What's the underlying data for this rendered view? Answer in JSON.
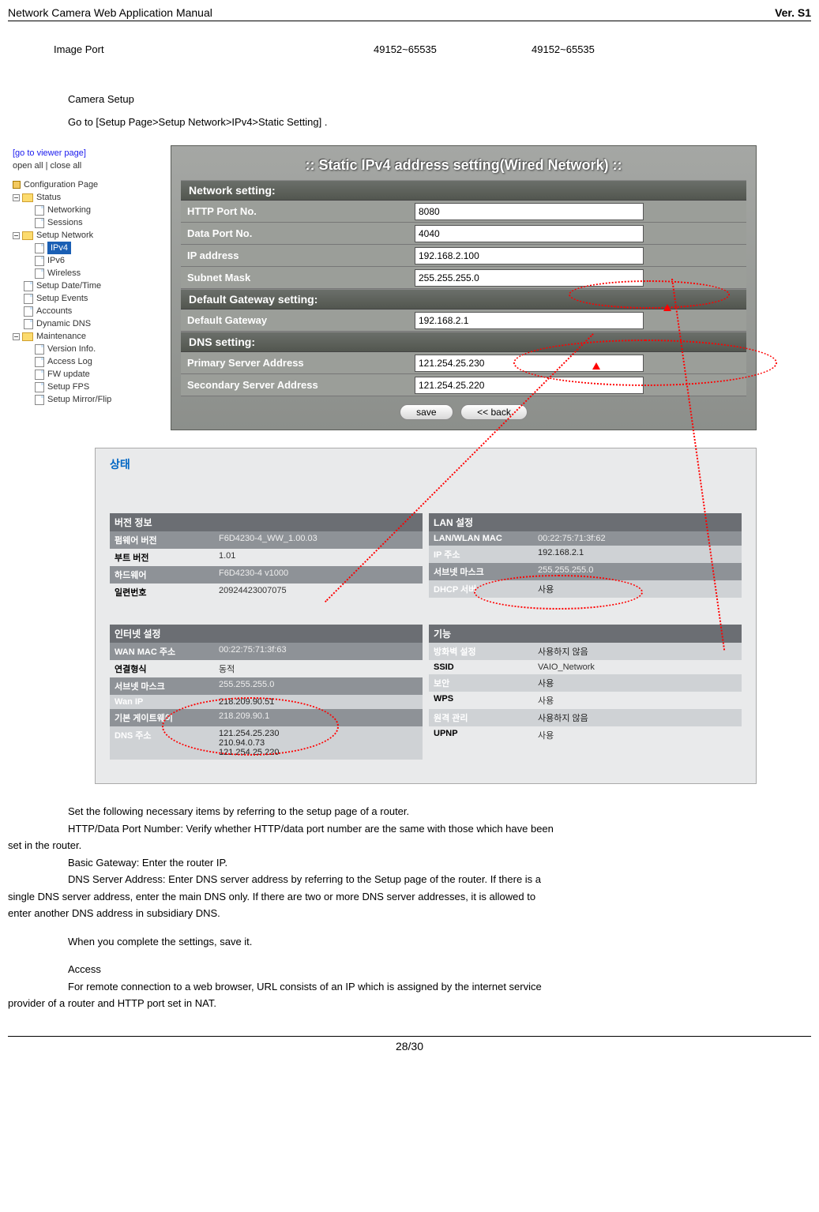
{
  "header": {
    "left": "Network Camera Web Application Manual",
    "right": "Ver. S1"
  },
  "port_row": {
    "label": "Image Port",
    "col1": "49152~65535",
    "col2": "49152~65535"
  },
  "section": {
    "camera_setup": "Camera Setup",
    "goto": "Go to [Setup Page>Setup Network>IPv4>Static Setting] ."
  },
  "nav": {
    "viewer_link": "[go to viewer page]",
    "open_close": "open all | close all",
    "config_page": "Configuration Page",
    "status": "Status",
    "networking": "Networking",
    "sessions": "Sessions",
    "setup_network": "Setup Network",
    "ipv4": "IPv4",
    "ipv6": "IPv6",
    "wireless": "Wireless",
    "setup_datetime": "Setup Date/Time",
    "setup_events": "Setup Events",
    "accounts": "Accounts",
    "dynamic_dns": "Dynamic DNS",
    "maintenance": "Maintenance",
    "version_info": "Version Info.",
    "access_log": "Access Log",
    "fw_update": "FW update",
    "setup_fps": "Setup FPS",
    "setup_mirror": "Setup Mirror/Flip"
  },
  "ipv4": {
    "title": ":: Static IPv4 address setting(Wired Network) ::",
    "network_setting": "Network setting:",
    "http": {
      "label": "HTTP Port No.",
      "value": "8080"
    },
    "data": {
      "label": "Data Port No.",
      "value": "4040"
    },
    "ip": {
      "label": "IP address",
      "value": "192.168.2.100"
    },
    "subnet": {
      "label": "Subnet Mask",
      "value": "255.255.255.0"
    },
    "gateway_setting": "Default Gateway setting:",
    "gateway": {
      "label": "Default Gateway",
      "value": "192.168.2.1"
    },
    "dns_setting": "DNS setting:",
    "primary": {
      "label": "Primary Server Address",
      "value": "121.254.25.230"
    },
    "secondary": {
      "label": "Secondary Server Address",
      "value": "121.254.25.220"
    },
    "save_btn": "save",
    "back_btn": "<< back"
  },
  "router": {
    "title": "상태",
    "version_info": "버전 정보",
    "firmware_l": "펌웨어 버전",
    "firmware_v": "F6D4230-4_WW_1.00.03",
    "boot_l": "부트 버전",
    "boot_v": "1.01",
    "hw_l": "하드웨어",
    "hw_v": "F6D4230-4 v1000",
    "serial_l": "일련번호",
    "serial_v": "20924423007075",
    "lan_setting": "LAN 설정",
    "lanmac_l": "LAN/WLAN MAC",
    "lanmac_v": "00:22:75:71:3f:62",
    "ipaddr_l": "IP 주소",
    "ipaddr_v": "192.168.2.1",
    "snmask_l": "서브넷 마스크",
    "snmask_v": "255.255.255.0",
    "dhcp_l": "DHCP 서버",
    "dhcp_v": "사용",
    "inet_setting": "인터넷 설정",
    "wanmac_l": "WAN MAC 주소",
    "wanmac_v": "00:22:75:71:3f:63",
    "conn_l": "연결형식",
    "conn_v": "동적",
    "snmask2_l": "서브넷 마스크",
    "snmask2_v": "255.255.255.0",
    "wanip_l": "Wan IP",
    "wanip_v": "218.209.90.51",
    "defgw_l": "기본 게이트웨이",
    "defgw_v": "218.209.90.1",
    "dns_l": "DNS 주소",
    "dns_v1": "121.254.25.230",
    "dns_v2": "210.94.0.73",
    "dns_v3": "121.254.25.220",
    "feature": "기능",
    "fw_l": "방화벽 설정",
    "fw_v": "사용하지 않음",
    "ssid_l": "SSID",
    "ssid_v": "VAIO_Network",
    "sec_l": "보안",
    "sec_v": "사용",
    "wps_l": "WPS",
    "wps_v": "사용",
    "remote_l": "원격 관리",
    "remote_v": "사용하지 않음",
    "upnp_l": "UPNP",
    "upnp_v": "사용"
  },
  "body": {
    "p1": "Set the following necessary items by referring to the setup page of a router.",
    "p2a": "HTTP/Data Port Number: Verify whether HTTP/data port number are the same with those which have been",
    "p2b": "set in the router.",
    "p3": "Basic Gateway: Enter the router IP.",
    "p4a": "DNS Server Address: Enter DNS server address by referring to the Setup page of the router.   If there is a",
    "p4b": "single DNS server address, enter the main DNS only. If there are two or more DNS server addresses, it is allowed to",
    "p4c": "enter another DNS address in subsidiary DNS.",
    "p5": "When you complete the settings, save it.",
    "p6": "Access",
    "p7a": "For remote connection to a web browser, URL consists of an IP which is assigned by the internet service",
    "p7b": "provider of a router and HTTP port set in NAT."
  },
  "footer": {
    "page": "28/30"
  }
}
